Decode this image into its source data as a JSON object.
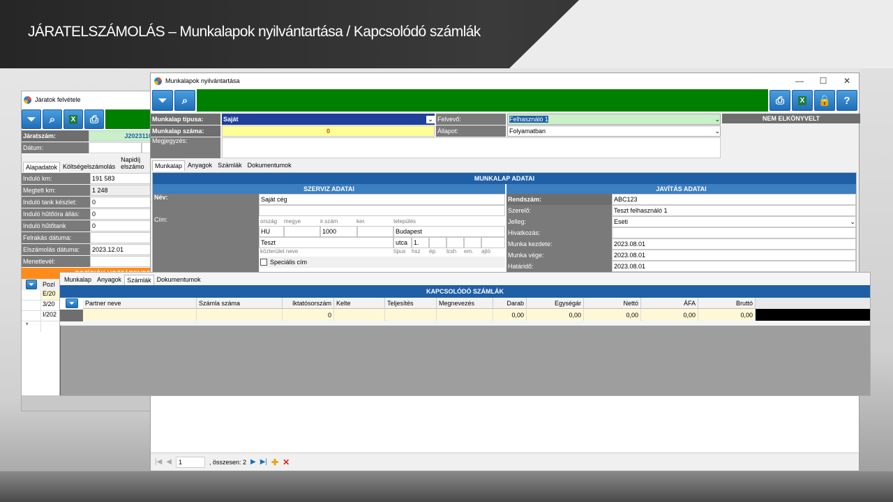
{
  "slide_title": "JÁRATELSZÁMOLÁS – Munkalapok nyilvántartása / Kapcsolódó számlák",
  "back_window": {
    "title": "Járatok felvétele",
    "jaratszam_label": "Járatszám:",
    "jaratszam_value": "J2023110",
    "datum_label": "Dátum:",
    "tabs": [
      "Alapadatok",
      "Költségelszámolás",
      "Napidíj elszámo"
    ],
    "fields": [
      {
        "label": "Induló km:",
        "value": "191 583"
      },
      {
        "label": "Megtett km:",
        "value": "1 248"
      },
      {
        "label": "Induló tank készlet:",
        "value": "0"
      },
      {
        "label": "Induló hűtőóra állás:",
        "value": "0"
      },
      {
        "label": "Induló hűtőtank",
        "value": "0"
      },
      {
        "label": "Felrakás dátuma:",
        "value": ""
      },
      {
        "label": "Elszámolás dátuma:",
        "value": "2023.12.01"
      },
      {
        "label": "Menetlevél:",
        "value": ""
      }
    ],
    "orange_bar": "POZÍCIÓK HOZZÁRENDE",
    "pos_col": "Pozí",
    "pos_rows": [
      "E/20",
      "3/20",
      "I/202",
      "*"
    ]
  },
  "main_window": {
    "title": "Munkalapok nyilvántartása",
    "win_controls": [
      "—",
      "☐",
      "✕"
    ],
    "munkalap_tipusa_label": "Munkalap típusa:",
    "munkalap_tipusa_value": "Saját",
    "munkalap_szama_label": "Munkalap száma:",
    "munkalap_szama_value": "0",
    "megjegyzes_label": "Megjegyzés:",
    "felvevo_label": "Felvevő:",
    "felvevo_value": "Felhasználó 1",
    "allapot_label": "Állapot:",
    "allapot_value": "Folyamatban",
    "status_badge": "NEM ELKÖNYVELT",
    "tabs": [
      "Munkalap",
      "Anyagok",
      "Számlák",
      "Dokumentumok"
    ],
    "munkalap_adatai": "MUNKALAP ADATAI",
    "szerviz_adatai": "SZERVIZ ADATAI",
    "javitas_adatai": "JAVÍTÁS ADATAI",
    "nev_label": "Név:",
    "nev_value": "Saját cég",
    "cim_label": "Cím:",
    "addr_headers": [
      "ország",
      "megye",
      "ir.szám",
      "ker.",
      "település"
    ],
    "orszag": "HU",
    "irszam": "1000",
    "telepules": "Budapest",
    "kozterulet": "Teszt",
    "tipus": "utca",
    "hsz": "1.",
    "addr_sub": [
      "közterület neve",
      "típus",
      "hsz",
      "ép.",
      "lcsh",
      "em.",
      "ajtó"
    ],
    "specialis_cim": "Speciális cím",
    "rendszam_label": "Rendszám:",
    "rendszam_value": "ABC123",
    "szerelo_label": "Szerelő:",
    "szerelo_value": "Teszt felhasználó 1",
    "jelleg_label": "Jelleg:",
    "jelleg_value": "Eseti",
    "hivatkozas_label": "Hivatkozás:",
    "munka_kezdete_label": "Munka kezdete:",
    "munka_kezdete_value": "2023.08.01",
    "munka_vege_label": "Munka vége:",
    "munka_vege_value": "2023.08.01",
    "hatarido_label": "Határidő:",
    "hatarido_value": "2023.08.01",
    "nav": {
      "page": "1",
      "total": ", összesen: 2"
    }
  },
  "szamlak_panel": {
    "tabs": [
      "Munkalap",
      "Anyagok",
      "Számlák",
      "Dokumentumok"
    ],
    "header": "KAPCSOLÓDÓ SZÁMLÁK",
    "columns": [
      "Partner neve",
      "Számla száma",
      "Iktatósorszám",
      "Kelte",
      "Teljesítés",
      "Megnevezés",
      "Darab",
      "Egységár",
      "Nettó",
      "ÁFA",
      "Bruttó"
    ],
    "row": [
      "",
      "",
      "0",
      "",
      "",
      "",
      "0,00",
      "0,00",
      "0,00",
      "0,00",
      "0,00"
    ]
  }
}
